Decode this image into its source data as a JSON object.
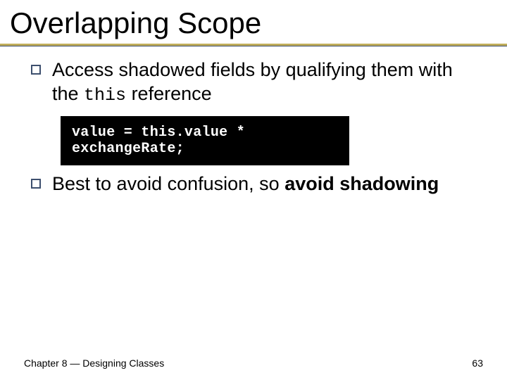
{
  "title": "Overlapping Scope",
  "bullets": [
    {
      "prefix": "Access shadowed fields by qualifying them with the ",
      "kw": "this",
      "suffix": " reference"
    },
    {
      "prefix": "Best to avoid confusion, so ",
      "emph": "avoid shadowing",
      "suffix": ""
    }
  ],
  "code_line": "value = this.value * exchangeRate;",
  "footer": {
    "left": "Chapter 8 — Designing Classes",
    "right": "63"
  }
}
